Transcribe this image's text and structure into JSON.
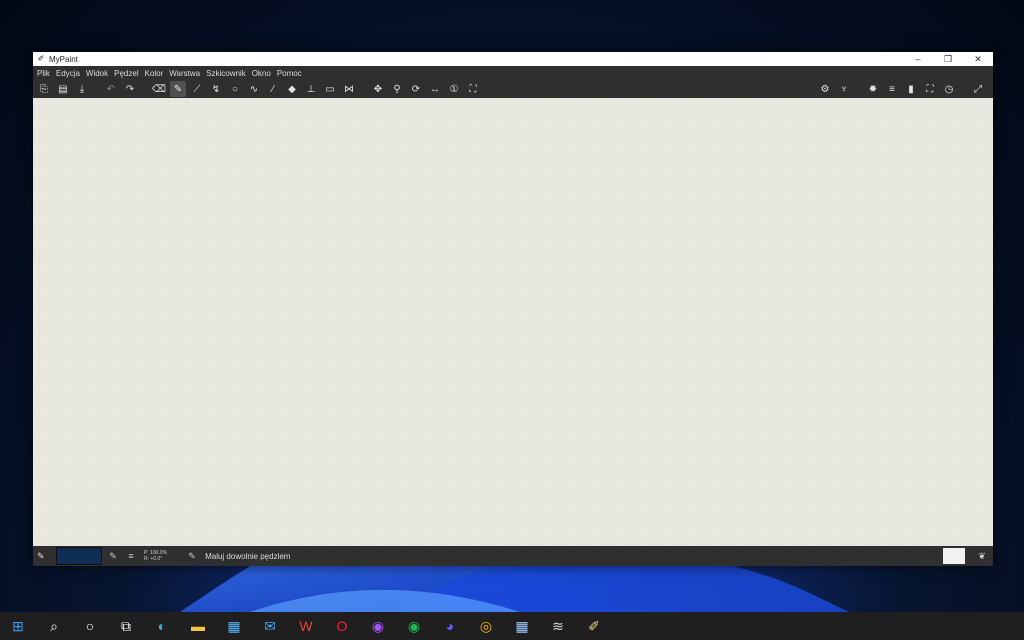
{
  "window": {
    "title": "MyPaint",
    "controls": {
      "minimize": "–",
      "restore": "❐",
      "close": "✕"
    }
  },
  "menu": [
    "Plik",
    "Edycja",
    "Widok",
    "Pędzel",
    "Kolor",
    "Warstwa",
    "Szkicownik",
    "Okno",
    "Pomoc"
  ],
  "toolbar": {
    "left": [
      {
        "name": "new-document-icon",
        "glyph": "⎘"
      },
      {
        "name": "open-document-icon",
        "glyph": "▤"
      },
      {
        "name": "save-document-icon",
        "glyph": "⤓"
      },
      {
        "gap": true
      },
      {
        "name": "undo-icon",
        "glyph": "↶",
        "dim": true
      },
      {
        "name": "redo-icon",
        "glyph": "↷"
      },
      {
        "gap": true
      },
      {
        "name": "eraser-icon",
        "glyph": "⌫"
      },
      {
        "name": "freehand-brush-icon",
        "glyph": "✎",
        "active": true
      },
      {
        "name": "inking-icon",
        "glyph": "⟋"
      },
      {
        "name": "lasso-icon",
        "glyph": "↯"
      },
      {
        "name": "ellipse-icon",
        "glyph": "○"
      },
      {
        "name": "lines-curves-icon",
        "glyph": "∿"
      },
      {
        "name": "color-picker-icon",
        "glyph": "⁄"
      },
      {
        "name": "fill-icon",
        "glyph": "◆"
      },
      {
        "name": "symmetry-icon",
        "glyph": "⊥"
      },
      {
        "name": "frame-icon",
        "glyph": "▭"
      },
      {
        "name": "butterfly-icon",
        "glyph": "⋈"
      },
      {
        "gap": true
      },
      {
        "name": "pan-view-icon",
        "glyph": "✥"
      },
      {
        "name": "zoom-view-icon",
        "glyph": "⚲"
      },
      {
        "name": "rotate-view-icon",
        "glyph": "⟳"
      },
      {
        "name": "fit-width-icon",
        "glyph": "↔"
      },
      {
        "name": "zoom-one-icon",
        "glyph": "①"
      },
      {
        "name": "fit-view-icon",
        "glyph": "⛶"
      }
    ],
    "right": [
      {
        "name": "brush-settings-icon",
        "glyph": "⚙"
      },
      {
        "name": "brushes-icon",
        "glyph": "♆"
      },
      {
        "gap": true
      },
      {
        "name": "settings-gear-icon",
        "glyph": "✹"
      },
      {
        "name": "menu-lines-icon",
        "glyph": "≡"
      },
      {
        "name": "scratchpad-icon",
        "glyph": "▮"
      },
      {
        "name": "fullscreen-icon",
        "glyph": "⛶"
      },
      {
        "name": "clock-icon",
        "glyph": "◷"
      },
      {
        "gap": true
      },
      {
        "name": "expand-icon",
        "glyph": "⤢"
      }
    ]
  },
  "status": {
    "brush_glyph": "✎",
    "color": "#0e2e55",
    "readout_zoom": "P: 100.0%",
    "readout_rotation": "R: +0.0°",
    "message": "Maluj dowolnie pędzlem"
  },
  "taskbar": [
    {
      "name": "windows-start-icon",
      "glyph": "⊞",
      "color": "#3aa0ff"
    },
    {
      "name": "search-icon",
      "glyph": "⌕",
      "color": "#ffffff"
    },
    {
      "name": "cortana-icon",
      "glyph": "○",
      "color": "#ffffff"
    },
    {
      "name": "task-view-icon",
      "glyph": "⧉",
      "color": "#ffffff"
    },
    {
      "name": "edge-icon",
      "glyph": "◐",
      "color": "#32b6e8"
    },
    {
      "name": "file-explorer-icon",
      "glyph": "▬",
      "color": "#f5c542"
    },
    {
      "name": "store-icon",
      "glyph": "▦",
      "color": "#59b4ff"
    },
    {
      "name": "mail-icon",
      "glyph": "✉",
      "color": "#4aa3ff"
    },
    {
      "name": "wps-icon",
      "glyph": "W",
      "color": "#e8453c"
    },
    {
      "name": "opera-icon",
      "glyph": "O",
      "color": "#ff1b2d"
    },
    {
      "name": "messenger-icon",
      "glyph": "◉",
      "color": "#a455ff"
    },
    {
      "name": "spotify-icon",
      "glyph": "◉",
      "color": "#1db954"
    },
    {
      "name": "discord-icon",
      "glyph": "◕",
      "color": "#5865f2"
    },
    {
      "name": "chrome-icon",
      "glyph": "◎",
      "color": "#fbbc05"
    },
    {
      "name": "calculator-icon",
      "glyph": "▦",
      "color": "#9ec9ff"
    },
    {
      "name": "scanner-icon",
      "glyph": "≋",
      "color": "#c8e0c8"
    },
    {
      "name": "mypaint-icon",
      "glyph": "✐",
      "color": "#f0d080"
    }
  ]
}
